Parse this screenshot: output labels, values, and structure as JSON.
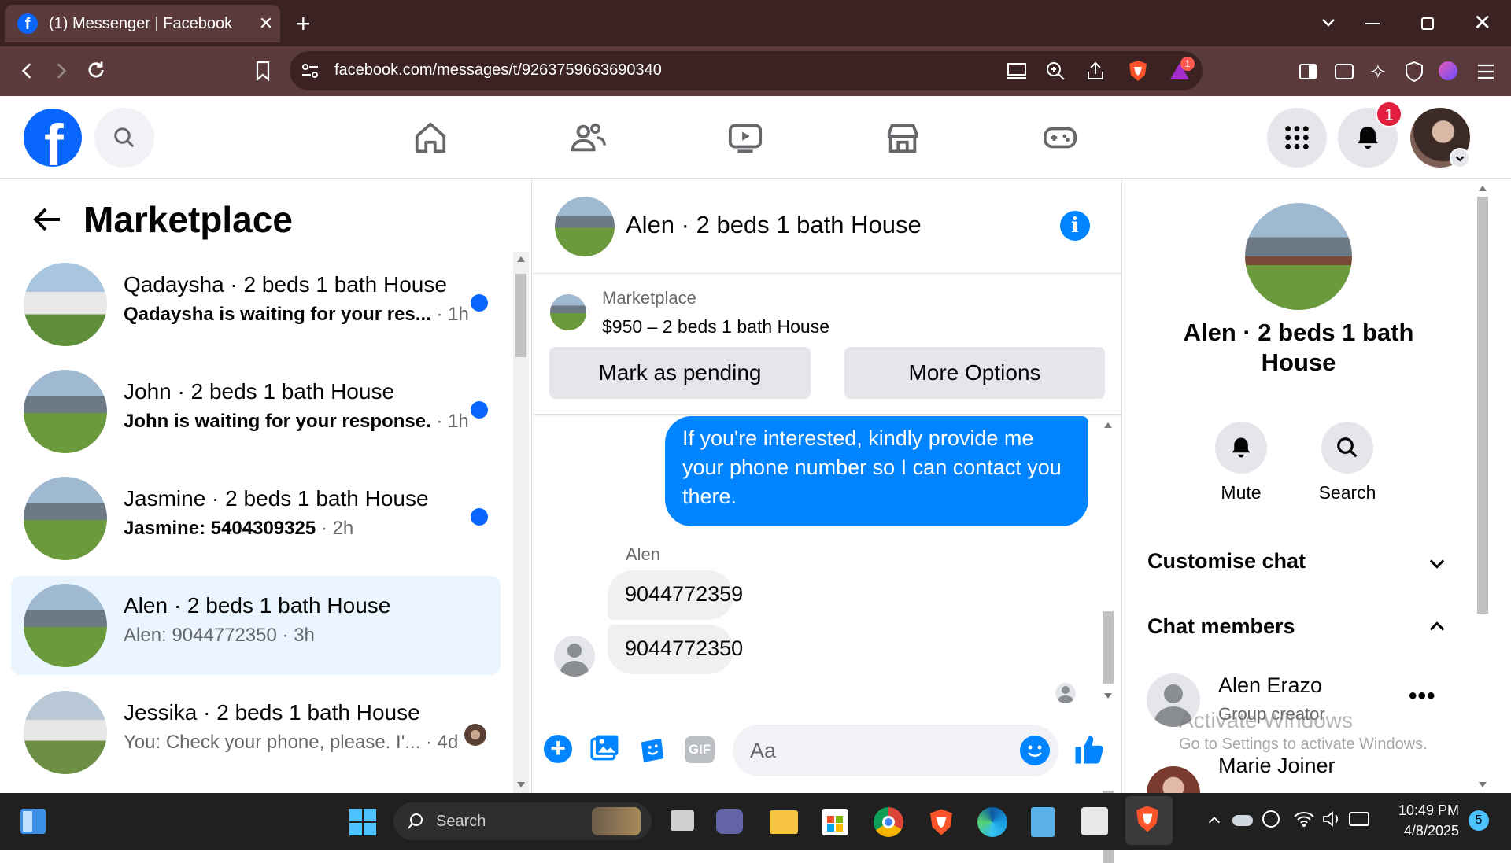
{
  "browser": {
    "tab_title": "(1) Messenger | Facebook",
    "url": "facebook.com/messages/t/9263759663690340",
    "brave_badge": "1",
    "icons": [
      "facebook-favicon",
      "close-icon",
      "plus-icon",
      "chevron-down-icon",
      "minimize-icon",
      "restore-icon",
      "window-close-icon",
      "back-icon",
      "forward-icon",
      "reload-icon",
      "bookmark-icon",
      "site-info-icon",
      "cast-icon",
      "zoom-icon",
      "share-icon",
      "brave-shields-icon",
      "brave-rewards-icon",
      "sidebar-icon",
      "wallet-icon",
      "leo-icon",
      "vpn-icon",
      "profile-icon",
      "menu-icon"
    ]
  },
  "fb": {
    "notif_count": "1",
    "nav": [
      "home-icon",
      "friends-icon",
      "watch-icon",
      "marketplace-icon",
      "gaming-icon"
    ]
  },
  "left": {
    "title": "Marketplace",
    "conversations": [
      {
        "name": "Qadaysha · 2 beds 1 bath House",
        "preview": "Qadaysha is waiting for your res...",
        "time": " · 1h",
        "unread": true
      },
      {
        "name": "John · 2 beds 1 bath House",
        "preview": "John is waiting for your response.",
        "time": " · 1h",
        "unread": true
      },
      {
        "name": "Jasmine · 2 beds 1 bath House",
        "preview": "Jasmine: 5404309325",
        "time": " · 2h",
        "unread": true
      },
      {
        "name": "Alen · 2 beds 1 bath House",
        "preview": "Alen: 9044772350",
        "time": " · 3h",
        "unread": false,
        "selected": true
      },
      {
        "name": "Jessika · 2 beds 1 bath House",
        "preview": "You: Check your phone, please. I'...",
        "time": " · 4d",
        "unread": false
      }
    ]
  },
  "chat": {
    "title": "Alen · 2 beds 1 bath House",
    "listing_source": "Marketplace",
    "listing_title": "$950 – 2 beds 1 bath House",
    "mark_pending": "Mark as pending",
    "more_options": "More Options",
    "outgoing_message": "If you're interested, kindly provide me your phone number so I can contact you there.",
    "sender_name": "Alen",
    "incoming_1": "9044772359",
    "incoming_2": "9044772350",
    "composer_placeholder": "Aa"
  },
  "info": {
    "title": "Alen · 2 beds 1 bath House",
    "mute": "Mute",
    "search": "Search",
    "customise": "Customise chat",
    "members": "Chat members",
    "member1_name": "Alen Erazo",
    "member1_role": "Group creator",
    "member2_name": "Marie Joiner",
    "watermark_1": "Activate Windows",
    "watermark_2": "Go to Settings to activate Windows."
  },
  "taskbar": {
    "search": "Search",
    "time": "10:49 PM",
    "date": "4/8/2025",
    "notif_count": "5"
  },
  "colors": {
    "fb_blue": "#0866ff",
    "messenger_blue": "#0084ff",
    "chrome_dark": "#3c2323",
    "chrome_mid": "#5a3a3a"
  }
}
